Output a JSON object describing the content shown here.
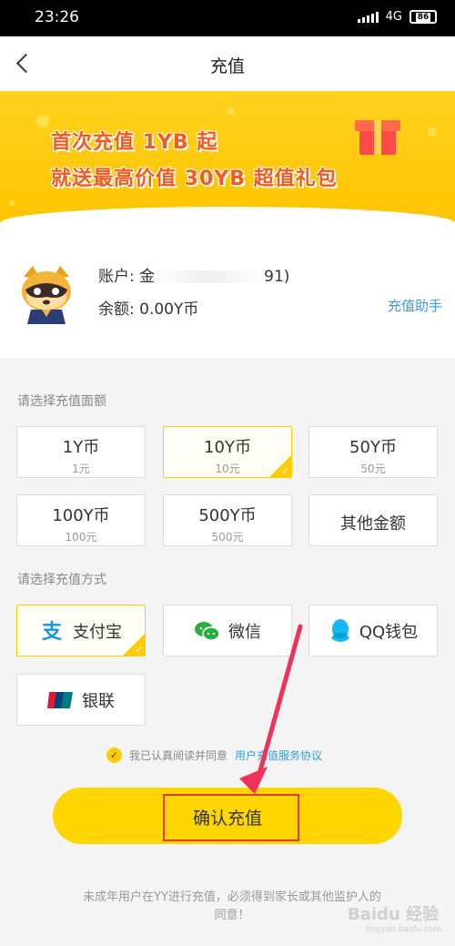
{
  "status_bar": {
    "time": "23:26",
    "network": "4G",
    "battery": "86"
  },
  "nav": {
    "title": "充值",
    "back_icon": "chevron-left-icon"
  },
  "banner": {
    "line1": "首次充值 1YB 起",
    "line2": "就送最高价值 30YB 超值礼包",
    "text_color": "#f55a1e",
    "background": "#ffc400"
  },
  "account": {
    "user_label": "账户: 金",
    "user_tail": "91)",
    "balance_label": "余额: 0.00Y币",
    "helper_link": "充值助手"
  },
  "amount_section": {
    "label": "请选择充值面额",
    "options": [
      {
        "main": "1Y币",
        "sub": "1元",
        "selected": false
      },
      {
        "main": "10Y币",
        "sub": "10元",
        "selected": true
      },
      {
        "main": "50Y币",
        "sub": "50元",
        "selected": false
      },
      {
        "main": "100Y币",
        "sub": "100元",
        "selected": false
      },
      {
        "main": "500Y币",
        "sub": "500元",
        "selected": false
      },
      {
        "main": "其他金额",
        "sub": "",
        "selected": false
      }
    ]
  },
  "payment_section": {
    "label": "请选择充值方式",
    "methods": [
      {
        "label": "支付宝",
        "icon": "alipay-icon",
        "selected": true
      },
      {
        "label": "微信",
        "icon": "wechat-icon",
        "selected": false
      },
      {
        "label": "QQ钱包",
        "icon": "qq-icon",
        "selected": false
      },
      {
        "label": "银联",
        "icon": "unionpay-icon",
        "selected": false
      }
    ]
  },
  "agreement": {
    "prefix": "我已认真阅读并同意",
    "link": "用户充值服务协议"
  },
  "confirm": {
    "label": "确认充值"
  },
  "notice": "未成年用户在YY进行充值，必须得到家长或其他监护人的同意！",
  "watermark": {
    "main": "Baidu 经验",
    "sub": "jingyan.baidu.com"
  },
  "colors": {
    "accent": "#ffcc00",
    "link": "#3a9ad9",
    "annotation_red": "#e8383d"
  }
}
